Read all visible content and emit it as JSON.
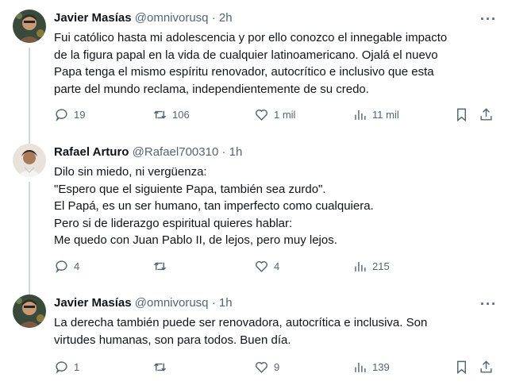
{
  "tweets": [
    {
      "name": "Javier Masías",
      "handle": "@omnivorusq",
      "time": "· 2h",
      "lines": [
        "Fui católico hasta mi adolescencia y por ello conozco el innegable impacto",
        "de la figura papal en la vida de cualquier latinoamericano. Ojalá el nuevo",
        "Papa tenga el mismo espíritu renovador, autocrítico e inclusivo que esta",
        "parte del mundo reclama, independientemente de su credo."
      ],
      "replies": "19",
      "retweets": "106",
      "likes": "1 mil",
      "views": "11 mil"
    },
    {
      "name": "Rafael Arturo",
      "handle": "@Rafael700310",
      "time": "· 1h",
      "lines": [
        "Dilo sin miedo, ni vergüenza:",
        "\"Espero que el siguiente Papa, también sea zurdo\".",
        "El Papá, es un ser humano, tan imperfecto como cualquiera.",
        "Pero si de liderazgo espiritual quieres hablar:",
        "Me quedo con Juan Pablo II, de lejos, pero muy lejos."
      ],
      "replies": "4",
      "retweets": "",
      "likes": "4",
      "views": "215"
    },
    {
      "name": "Javier Masías",
      "handle": "@omnivorusq",
      "time": "· 1h",
      "lines": [
        "La derecha también puede ser renovadora, autocrítica e inclusiva. Son",
        "virtudes humanas, son para todos. Buen día."
      ],
      "replies": "1",
      "retweets": "",
      "likes": "9",
      "views": "139"
    }
  ],
  "more_label": "···",
  "icons": [
    "reply-icon",
    "retweet-icon",
    "like-icon",
    "views-icon",
    "bookmark-icon",
    "share-icon"
  ]
}
